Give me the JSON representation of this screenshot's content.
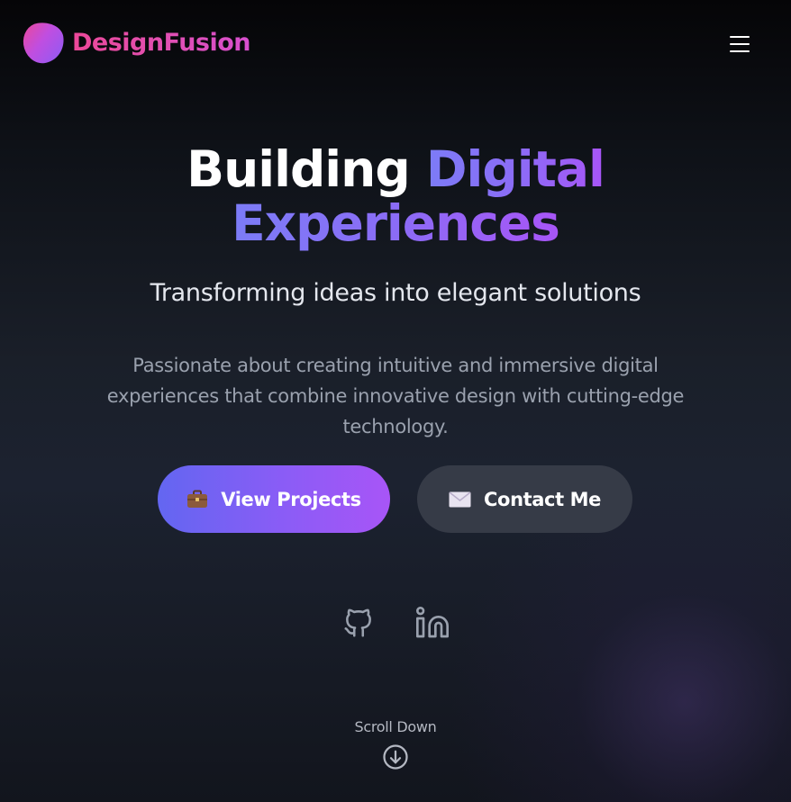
{
  "header": {
    "brand": "DesignFusion",
    "menu_icon": "hamburger-menu-icon"
  },
  "hero": {
    "title_part1": "Building ",
    "title_part2": "Digital",
    "title_line2": "Experiences",
    "subtitle": "Transforming ideas into elegant solutions",
    "description": "Passionate about creating intuitive and immersive digital experiences that combine innovative design with cutting-edge technology."
  },
  "buttons": {
    "primary_label": "View Projects",
    "primary_icon": "briefcase-icon",
    "secondary_label": "Contact Me",
    "secondary_icon": "envelope-icon"
  },
  "socials": [
    {
      "name": "github",
      "icon": "github-icon"
    },
    {
      "name": "linkedin",
      "icon": "linkedin-icon"
    }
  ],
  "scroll": {
    "label": "Scroll Down",
    "icon": "arrow-down-circle-icon"
  },
  "colors": {
    "accent_start": "#6366f1",
    "accent_end": "#a855f7",
    "brand_pink": "#ec4899",
    "secondary_button": "#363b47"
  }
}
